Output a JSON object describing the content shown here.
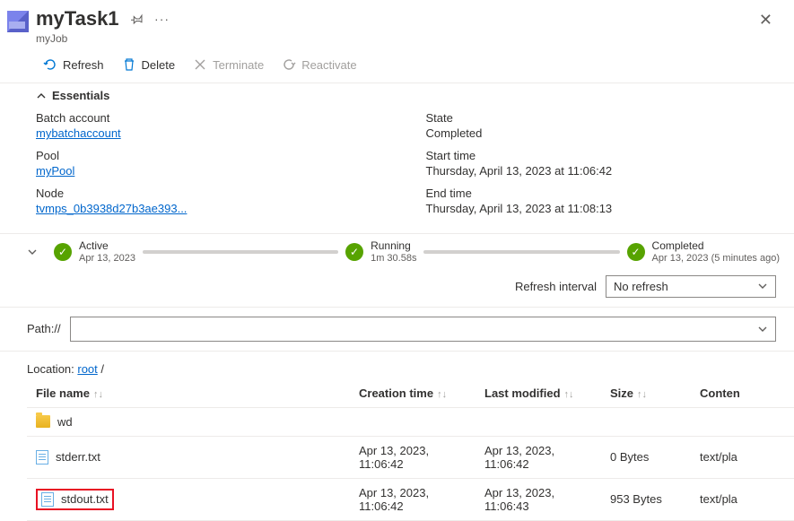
{
  "header": {
    "title": "myTask1",
    "subtitle": "myJob"
  },
  "toolbar": {
    "refresh": "Refresh",
    "delete": "Delete",
    "terminate": "Terminate",
    "reactivate": "Reactivate"
  },
  "essentials": {
    "heading": "Essentials",
    "left": {
      "batch_account_label": "Batch account",
      "batch_account_value": "mybatchaccount",
      "pool_label": "Pool",
      "pool_value": "myPool",
      "node_label": "Node",
      "node_value": "tvmps_0b3938d27b3ae393..."
    },
    "right": {
      "state_label": "State",
      "state_value": "Completed",
      "start_label": "Start time",
      "start_value": "Thursday, April 13, 2023 at 11:06:42",
      "end_label": "End time",
      "end_value": "Thursday, April 13, 2023 at 11:08:13"
    }
  },
  "timeline": {
    "active": {
      "title": "Active",
      "sub": "Apr 13, 2023"
    },
    "running": {
      "title": "Running",
      "sub": "1m 30.58s"
    },
    "completed": {
      "title": "Completed",
      "sub": "Apr 13, 2023 (5 minutes ago)"
    }
  },
  "refresh_interval": {
    "label": "Refresh interval",
    "value": "No refresh"
  },
  "path": {
    "label": "Path://"
  },
  "location": {
    "prefix": "Location: ",
    "root": "root",
    "suffix": " /"
  },
  "table": {
    "headers": {
      "file_name": "File name",
      "creation_time": "Creation time",
      "last_modified": "Last modified",
      "size": "Size",
      "content": "Conten"
    },
    "rows": [
      {
        "type": "folder",
        "name": "wd",
        "creation": "",
        "modified": "",
        "size": "",
        "content": ""
      },
      {
        "type": "file",
        "name": "stderr.txt",
        "creation": "Apr 13, 2023, 11:06:42",
        "modified": "Apr 13, 2023, 11:06:42",
        "size": "0 Bytes",
        "content": "text/pla"
      },
      {
        "type": "file",
        "name": "stdout.txt",
        "creation": "Apr 13, 2023, 11:06:42",
        "modified": "Apr 13, 2023, 11:06:43",
        "size": "953 Bytes",
        "content": "text/pla",
        "highlighted": true
      }
    ]
  }
}
